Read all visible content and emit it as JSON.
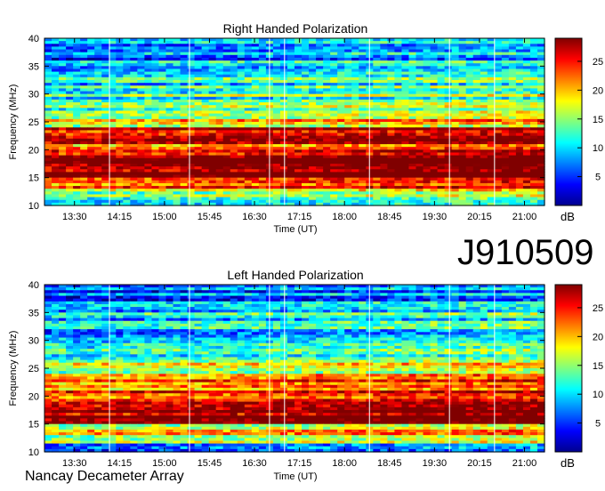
{
  "observation_id": "J910509",
  "instrument": "Nancay Decameter Array",
  "colors": {
    "frame": "#000000",
    "gridline": "#ffffff"
  },
  "chart_data": [
    {
      "type": "heatmap",
      "title": "Right Handed Polarization",
      "xlabel": "Time (UT)",
      "ylabel": "Frequency (MHz)",
      "colorbar_label": "dB",
      "colorscale": "jet",
      "xlim": [
        "13:00",
        "21:20"
      ],
      "ylim": [
        10,
        40
      ],
      "xticks": [
        "13:30",
        "14:15",
        "15:00",
        "15:45",
        "16:30",
        "17:15",
        "18:00",
        "18:45",
        "19:30",
        "20:15",
        "21:00"
      ],
      "yticks": [
        10,
        15,
        20,
        25,
        30,
        35,
        40
      ],
      "colorbar_range": [
        0,
        29
      ],
      "colorbar_ticks": [
        5,
        10,
        15,
        20,
        25
      ],
      "vertical_markers": [
        "14:05",
        "15:25",
        "16:45",
        "17:00",
        "18:25",
        "19:45",
        "20:30"
      ],
      "bands": [
        {
          "freq_range": [
            10,
            11.5
          ],
          "level": 8
        },
        {
          "freq_range": [
            11.5,
            13
          ],
          "level": 14
        },
        {
          "freq_range": [
            13,
            15
          ],
          "level": 22
        },
        {
          "freq_range": [
            15,
            19
          ],
          "level": 28
        },
        {
          "freq_range": [
            19,
            21
          ],
          "level": 22
        },
        {
          "freq_range": [
            21,
            24
          ],
          "level": 24
        },
        {
          "freq_range": [
            24,
            27
          ],
          "level": 17
        },
        {
          "freq_range": [
            27,
            31
          ],
          "level": 12
        },
        {
          "freq_range": [
            31,
            36
          ],
          "level": 10
        },
        {
          "freq_range": [
            36,
            40
          ],
          "level": 7
        }
      ]
    },
    {
      "type": "heatmap",
      "title": "Left Handed Polarization",
      "xlabel": "Time (UT)",
      "ylabel": "Frequency (MHz)",
      "colorbar_label": "dB",
      "colorscale": "jet",
      "xlim": [
        "13:00",
        "21:20"
      ],
      "ylim": [
        10,
        40
      ],
      "xticks": [
        "13:30",
        "14:15",
        "15:00",
        "15:45",
        "16:30",
        "17:15",
        "18:00",
        "18:45",
        "19:30",
        "20:15",
        "21:00"
      ],
      "yticks": [
        10,
        15,
        20,
        25,
        30,
        35,
        40
      ],
      "colorbar_range": [
        0,
        29
      ],
      "colorbar_ticks": [
        5,
        10,
        15,
        20,
        25
      ],
      "vertical_markers": [
        "14:05",
        "15:25",
        "16:45",
        "17:00",
        "18:25",
        "19:45",
        "20:30"
      ],
      "bands": [
        {
          "freq_range": [
            10,
            11.5
          ],
          "level": 7
        },
        {
          "freq_range": [
            11.5,
            13
          ],
          "level": 12
        },
        {
          "freq_range": [
            13,
            15
          ],
          "level": 18
        },
        {
          "freq_range": [
            15,
            19
          ],
          "level": 27
        },
        {
          "freq_range": [
            19,
            21
          ],
          "level": 22
        },
        {
          "freq_range": [
            21,
            24
          ],
          "level": 21
        },
        {
          "freq_range": [
            24,
            27
          ],
          "level": 15
        },
        {
          "freq_range": [
            27,
            31
          ],
          "level": 11
        },
        {
          "freq_range": [
            31,
            36
          ],
          "level": 9
        },
        {
          "freq_range": [
            36,
            40
          ],
          "level": 6
        }
      ]
    }
  ]
}
